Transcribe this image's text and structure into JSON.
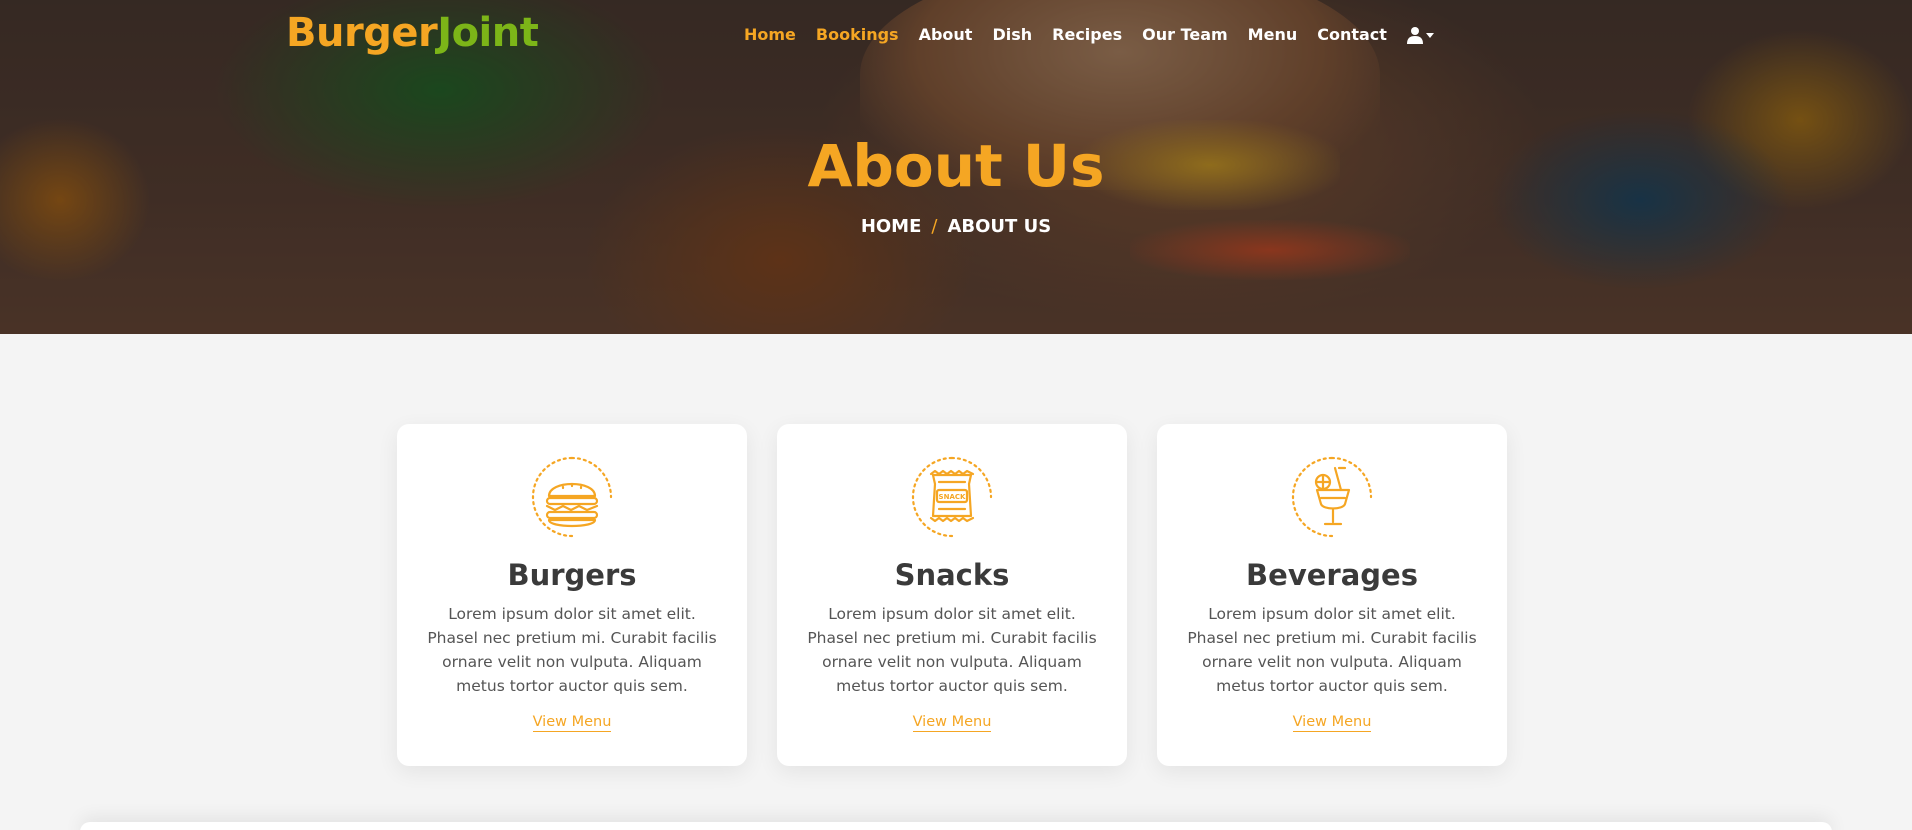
{
  "brand": {
    "part1": "Burger",
    "part2": "Joint",
    "color1": "#f5a623",
    "color2": "#7cb518"
  },
  "nav": {
    "items": [
      {
        "label": "Home",
        "active": true
      },
      {
        "label": "Bookings",
        "active": true
      },
      {
        "label": "About",
        "active": false
      },
      {
        "label": "Dish",
        "active": false
      },
      {
        "label": "Recipes",
        "active": false
      },
      {
        "label": "Our Team",
        "active": false
      },
      {
        "label": "Menu",
        "active": false
      },
      {
        "label": "Contact",
        "active": false
      }
    ],
    "user_icon": "user-icon"
  },
  "hero": {
    "title": "About Us",
    "breadcrumb": {
      "home": "HOME",
      "separator": "/",
      "current": "ABOUT US"
    }
  },
  "cards": [
    {
      "icon": "burger-icon",
      "title": "Burgers",
      "text": "Lorem ipsum dolor sit amet elit. Phasel nec pretium mi. Curabit facilis ornare velit non vulputa. Aliquam metus tortor auctor quis sem.",
      "link": "View Menu"
    },
    {
      "icon": "snack-icon",
      "icon_text": "SNACK",
      "title": "Snacks",
      "text": "Lorem ipsum dolor sit amet elit. Phasel nec pretium mi. Curabit facilis ornare velit non vulputa. Aliquam metus tortor auctor quis sem.",
      "link": "View Menu"
    },
    {
      "icon": "beverage-icon",
      "title": "Beverages",
      "text": "Lorem ipsum dolor sit amet elit. Phasel nec pretium mi. Curabit facilis ornare velit non vulputa. Aliquam metus tortor auctor quis sem.",
      "link": "View Menu"
    }
  ],
  "colors": {
    "accent": "#f5a623",
    "heading": "#3a3a3a",
    "body_text": "#555555",
    "background": "#f4f4f4"
  }
}
